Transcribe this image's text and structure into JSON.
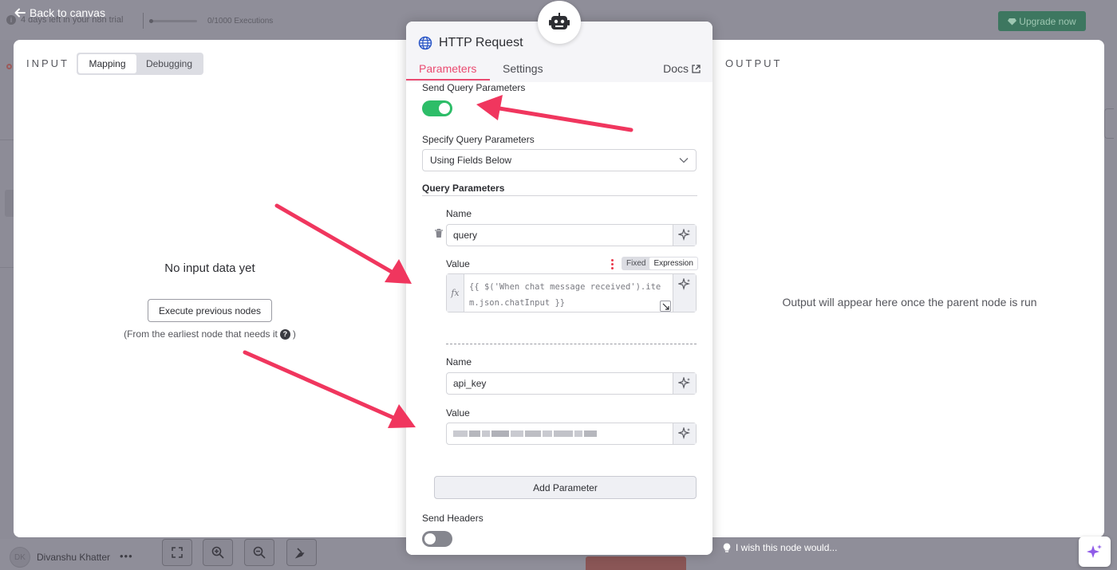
{
  "topbar": {
    "back_label": "Back to canvas",
    "trial_text": "4 days left in your n8n trial",
    "executions_text": "0/1000 Executions",
    "upgrade_label": "Upgrade now"
  },
  "input_panel": {
    "label": "INPUT",
    "tabs": [
      "Mapping",
      "Debugging"
    ],
    "active_tab": "Mapping",
    "empty_title": "No input data yet",
    "execute_button": "Execute previous nodes",
    "hint_prefix": "(From the earliest node that needs it",
    "hint_suffix": ")"
  },
  "node": {
    "title": "HTTP Request",
    "tabs": [
      "Parameters",
      "Settings"
    ],
    "active_tab": "Parameters",
    "docs_label": "Docs",
    "send_query_label": "Send Query Parameters",
    "send_query_on": true,
    "specify_label": "Specify Query Parameters",
    "specify_value": "Using Fields Below",
    "query_params_title": "Query Parameters",
    "params": [
      {
        "name_label": "Name",
        "name_value": "query",
        "value_label": "Value",
        "mode_options": [
          "Fixed",
          "Expression"
        ],
        "mode_active": "Expression",
        "value_expression": "{{ $('When chat message received').item.json.chatInput }}"
      },
      {
        "name_label": "Name",
        "name_value": "api_key",
        "value_label": "Value"
      }
    ],
    "add_parameter_label": "Add Parameter",
    "send_headers_label": "Send Headers",
    "send_headers_on": false
  },
  "output_panel": {
    "label": "OUTPUT",
    "empty_message": "Output will appear here once the parent node is run"
  },
  "footer": {
    "user_initials": "DK",
    "user_name": "Divanshu Khatter",
    "more": "•••",
    "wish_text": "I wish this node would..."
  },
  "colors": {
    "accent": "#ea4b71",
    "toggle_on": "#2dbd68",
    "annotation_arrow": "#f0365e"
  }
}
